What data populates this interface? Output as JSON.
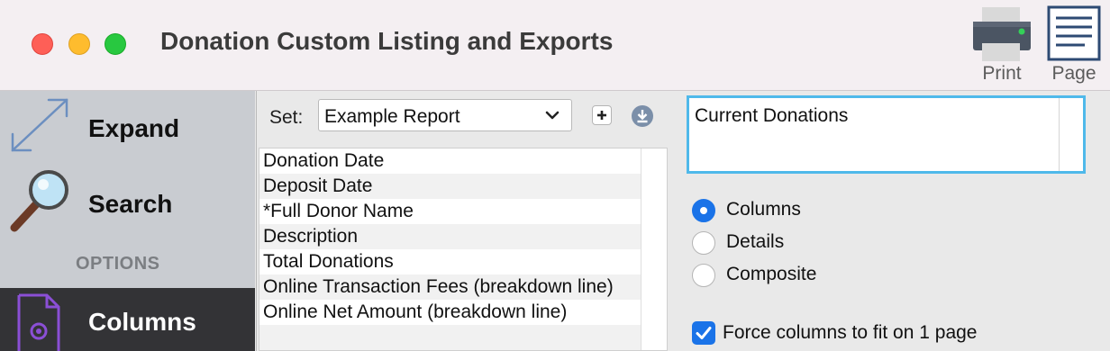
{
  "window": {
    "title": "Donation Custom Listing and Exports",
    "toolbar": {
      "print_label": "Print",
      "page_label": "Page"
    }
  },
  "sidebar": {
    "expand_label": "Expand",
    "search_label": "Search",
    "options_header": "OPTIONS",
    "columns_label": "Columns"
  },
  "set": {
    "label": "Set:",
    "selected": "Example Report"
  },
  "columns_list": [
    "Donation Date",
    "Deposit Date",
    "*Full Donor Name",
    "Description",
    "Total Donations",
    "Online Transaction Fees (breakdown line)",
    "Online Net Amount (breakdown line)"
  ],
  "description": "Current Donations",
  "layout_options": {
    "selected": "Columns",
    "options": [
      "Columns",
      "Details",
      "Composite"
    ]
  },
  "force_fit": {
    "label": "Force columns to fit on 1 page",
    "checked": true
  },
  "colors": {
    "accent": "#1a73e8",
    "focus_ring": "#4fb9ea",
    "sidebar_bg": "#c9ccd1",
    "active_item": "#333336"
  }
}
